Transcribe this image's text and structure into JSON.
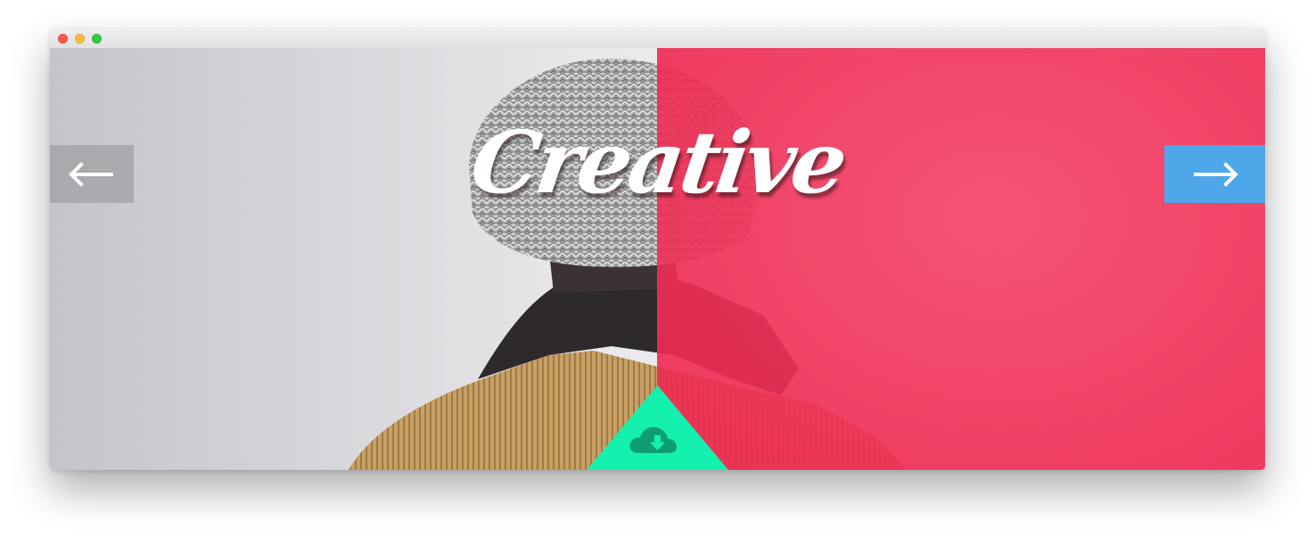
{
  "window": {
    "controls": [
      "close",
      "minimize",
      "maximize"
    ]
  },
  "hero": {
    "title": "Creative",
    "prev_icon": "arrow-left-icon",
    "next_icon": "arrow-right-icon",
    "download_icon": "cloud-download-icon"
  },
  "colors": {
    "accent_red": "#f33d62",
    "next_button": "#4da7e8",
    "prev_button": "#9a9a9f",
    "download": "#14f0ad",
    "download_icon": "#0e9e73"
  }
}
